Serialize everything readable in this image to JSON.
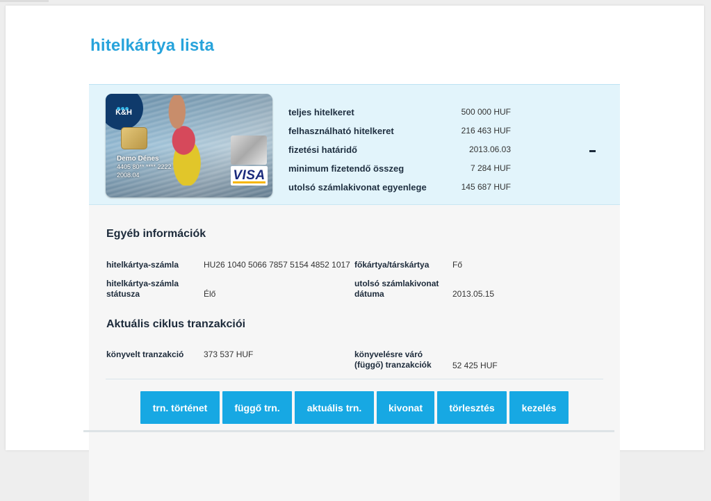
{
  "page": {
    "title": "hitelkártya lista"
  },
  "card": {
    "brand": "K&H",
    "holder": "Demo Dénes",
    "number": "4405 80** **** 2222",
    "expiry": "2008.04",
    "network": "VISA"
  },
  "summary": [
    {
      "label": "teljes hitelkeret",
      "value": "500 000 HUF"
    },
    {
      "label": "felhasználható hitelkeret",
      "value": "216 463 HUF"
    },
    {
      "label": "fizetési határidő",
      "value": "2013.06.03"
    },
    {
      "label": "minimum fizetendő összeg",
      "value": "7 284 HUF"
    },
    {
      "label": "utolsó számlakivonat egyenlege",
      "value": "145 687 HUF"
    }
  ],
  "collapse_label": "–",
  "other_info": {
    "title": "Egyéb információk",
    "account_label": "hitelkártya-számla",
    "account_value": "HU26 1040 5066 7857 5154 4852 1017",
    "type_label": "főkártya/társkártya",
    "type_value": "Fő",
    "status_label_line1": "hitelkártya-számla",
    "status_label_line2": "státusza",
    "status_value": "Élő",
    "statement_date_label_line1": "utolsó számlakivonat",
    "statement_date_label_line2": "dátuma",
    "statement_date_value": "2013.05.15"
  },
  "cycle": {
    "title": "Aktuális ciklus tranzakciói",
    "booked_label": "könyvelt tranzakció",
    "booked_value": "373 537 HUF",
    "pending_label_line1": "könyvelésre váró",
    "pending_label_line2": "(függő) tranzakciók",
    "pending_value": "52 425 HUF"
  },
  "buttons": {
    "history": "trn. történet",
    "pending": "függő trn.",
    "current": "aktuális trn.",
    "statement": "kivonat",
    "repayment": "törlesztés",
    "manage": "kezelés"
  },
  "colors": {
    "accent": "#27a3db",
    "button": "#17a8e3",
    "summary_bg": "#e2f4fb"
  }
}
